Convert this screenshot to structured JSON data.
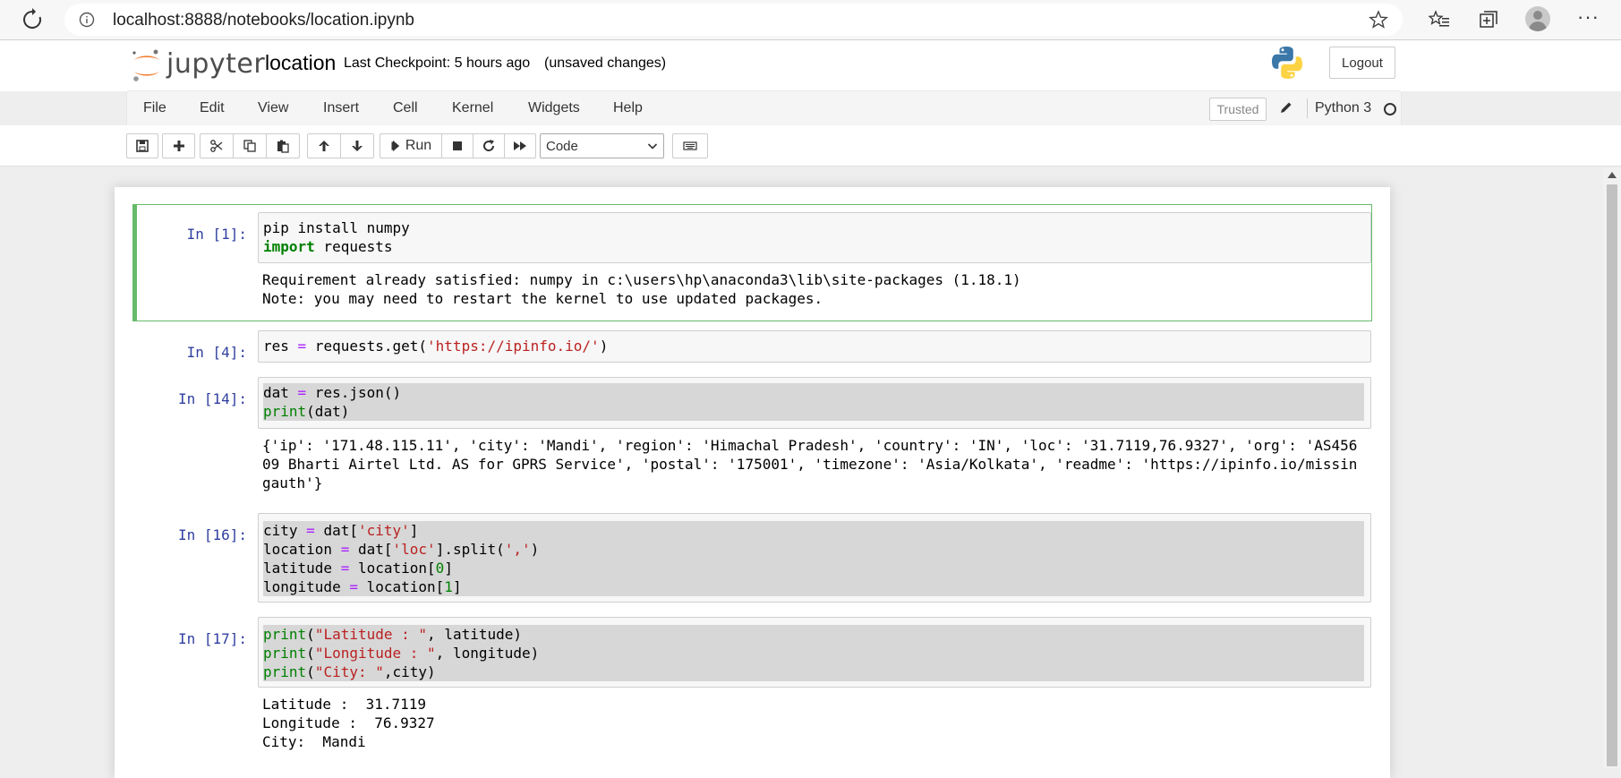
{
  "browser": {
    "url": "localhost:8888/notebooks/location.ipynb"
  },
  "header": {
    "logo_text": "jupyter",
    "notebook_name": "location",
    "checkpoint": "Last Checkpoint: 5 hours ago",
    "unsaved": "(unsaved changes)",
    "logout_label": "Logout"
  },
  "menubar": {
    "items": [
      "File",
      "Edit",
      "View",
      "Insert",
      "Cell",
      "Kernel",
      "Widgets",
      "Help"
    ],
    "trusted_label": "Trusted",
    "kernel_name": "Python 3"
  },
  "toolbar": {
    "run_label": "Run",
    "cell_type": "Code"
  },
  "cells": [
    {
      "prompt": "In [1]:",
      "code_lines": [
        [
          {
            "t": "pip install numpy",
            "c": ""
          }
        ],
        [
          {
            "t": "import",
            "c": "kw"
          },
          {
            "t": " requests",
            "c": ""
          }
        ]
      ],
      "output_lines": [
        "Requirement already satisfied: numpy in c:\\users\\hp\\anaconda3\\lib\\site-packages (1.18.1)",
        "Note: you may need to restart the kernel to use updated packages."
      ]
    },
    {
      "prompt": "In [4]:",
      "code_lines": [
        [
          {
            "t": "res ",
            "c": ""
          },
          {
            "t": "=",
            "c": "op"
          },
          {
            "t": " requests.get(",
            "c": ""
          },
          {
            "t": "'https://ipinfo.io/'",
            "c": "str"
          },
          {
            "t": ")",
            "c": ""
          }
        ]
      ],
      "output_lines": []
    },
    {
      "prompt": "In [14]:",
      "code_lines": [
        [
          {
            "t": "dat ",
            "c": ""
          },
          {
            "t": "=",
            "c": "op"
          },
          {
            "t": " res.json()",
            "c": ""
          }
        ],
        [
          {
            "t": "print",
            "c": "bi"
          },
          {
            "t": "(dat)",
            "c": ""
          }
        ]
      ],
      "output_lines": [
        "{'ip': '171.48.115.11', 'city': 'Mandi', 'region': 'Himachal Pradesh', 'country': 'IN', 'loc': '31.7119,76.9327', 'org': 'AS456",
        "09 Bharti Airtel Ltd. AS for GPRS Service', 'postal': '175001', 'timezone': 'Asia/Kolkata', 'readme': 'https://ipinfo.io/missin",
        "gauth'}"
      ]
    },
    {
      "prompt": "In [16]:",
      "code_lines": [
        [
          {
            "t": "city ",
            "c": ""
          },
          {
            "t": "=",
            "c": "op"
          },
          {
            "t": " dat[",
            "c": ""
          },
          {
            "t": "'city'",
            "c": "str"
          },
          {
            "t": "]",
            "c": ""
          }
        ],
        [
          {
            "t": "location ",
            "c": ""
          },
          {
            "t": "=",
            "c": "op"
          },
          {
            "t": " dat[",
            "c": ""
          },
          {
            "t": "'loc'",
            "c": "str"
          },
          {
            "t": "].split(",
            "c": ""
          },
          {
            "t": "','",
            "c": "str"
          },
          {
            "t": ")",
            "c": ""
          }
        ],
        [
          {
            "t": "latitude ",
            "c": ""
          },
          {
            "t": "=",
            "c": "op"
          },
          {
            "t": " location[",
            "c": ""
          },
          {
            "t": "0",
            "c": "num"
          },
          {
            "t": "]",
            "c": ""
          }
        ],
        [
          {
            "t": "longitude ",
            "c": ""
          },
          {
            "t": "=",
            "c": "op"
          },
          {
            "t": " location[",
            "c": ""
          },
          {
            "t": "1",
            "c": "num"
          },
          {
            "t": "]",
            "c": ""
          }
        ]
      ],
      "output_lines": []
    },
    {
      "prompt": "In [17]:",
      "code_lines": [
        [
          {
            "t": "print",
            "c": "bi"
          },
          {
            "t": "(",
            "c": ""
          },
          {
            "t": "\"Latitude : \"",
            "c": "str"
          },
          {
            "t": ", latitude)",
            "c": ""
          }
        ],
        [
          {
            "t": "print",
            "c": "bi"
          },
          {
            "t": "(",
            "c": ""
          },
          {
            "t": "\"Longitude : \"",
            "c": "str"
          },
          {
            "t": ", longitude)",
            "c": ""
          }
        ],
        [
          {
            "t": "print",
            "c": "bi"
          },
          {
            "t": "(",
            "c": ""
          },
          {
            "t": "\"City: \"",
            "c": "str"
          },
          {
            "t": ",city)",
            "c": ""
          }
        ]
      ],
      "output_lines": [
        "Latitude :  31.7119",
        "Longitude :  76.9327",
        "City:  Mandi"
      ]
    }
  ]
}
